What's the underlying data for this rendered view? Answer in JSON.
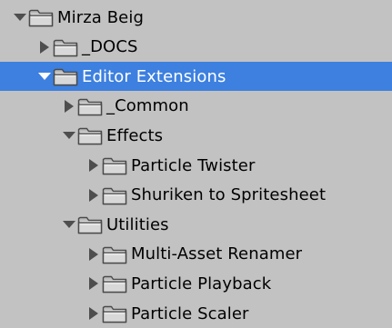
{
  "tree": {
    "items": [
      {
        "label": "Mirza Beig",
        "expanded": true,
        "depth": 0,
        "selected": false,
        "icon": "folder-icon"
      },
      {
        "label": "_DOCS",
        "expanded": false,
        "depth": 1,
        "selected": false,
        "icon": "folder-icon"
      },
      {
        "label": "Editor Extensions",
        "expanded": true,
        "depth": 1,
        "selected": true,
        "icon": "folder-icon"
      },
      {
        "label": "_Common",
        "expanded": false,
        "depth": 2,
        "selected": false,
        "icon": "folder-icon"
      },
      {
        "label": "Effects",
        "expanded": true,
        "depth": 2,
        "selected": false,
        "icon": "folder-icon"
      },
      {
        "label": "Particle Twister",
        "expanded": false,
        "depth": 3,
        "selected": false,
        "icon": "folder-icon"
      },
      {
        "label": "Shuriken to Spritesheet",
        "expanded": false,
        "depth": 3,
        "selected": false,
        "icon": "folder-icon"
      },
      {
        "label": "Utilities",
        "expanded": true,
        "depth": 2,
        "selected": false,
        "icon": "folder-icon"
      },
      {
        "label": "Multi-Asset Renamer",
        "expanded": false,
        "depth": 3,
        "selected": false,
        "icon": "folder-icon"
      },
      {
        "label": "Particle Playback",
        "expanded": false,
        "depth": 3,
        "selected": false,
        "icon": "folder-icon"
      },
      {
        "label": "Particle Scaler",
        "expanded": false,
        "depth": 3,
        "selected": false,
        "icon": "folder-icon"
      }
    ]
  },
  "colors": {
    "background": "#c2c2c2",
    "selection": "#3d80df",
    "arrow": "#4e4e4e",
    "folder_body": "#d8d8d8",
    "folder_outline": "#4a4a4a"
  }
}
